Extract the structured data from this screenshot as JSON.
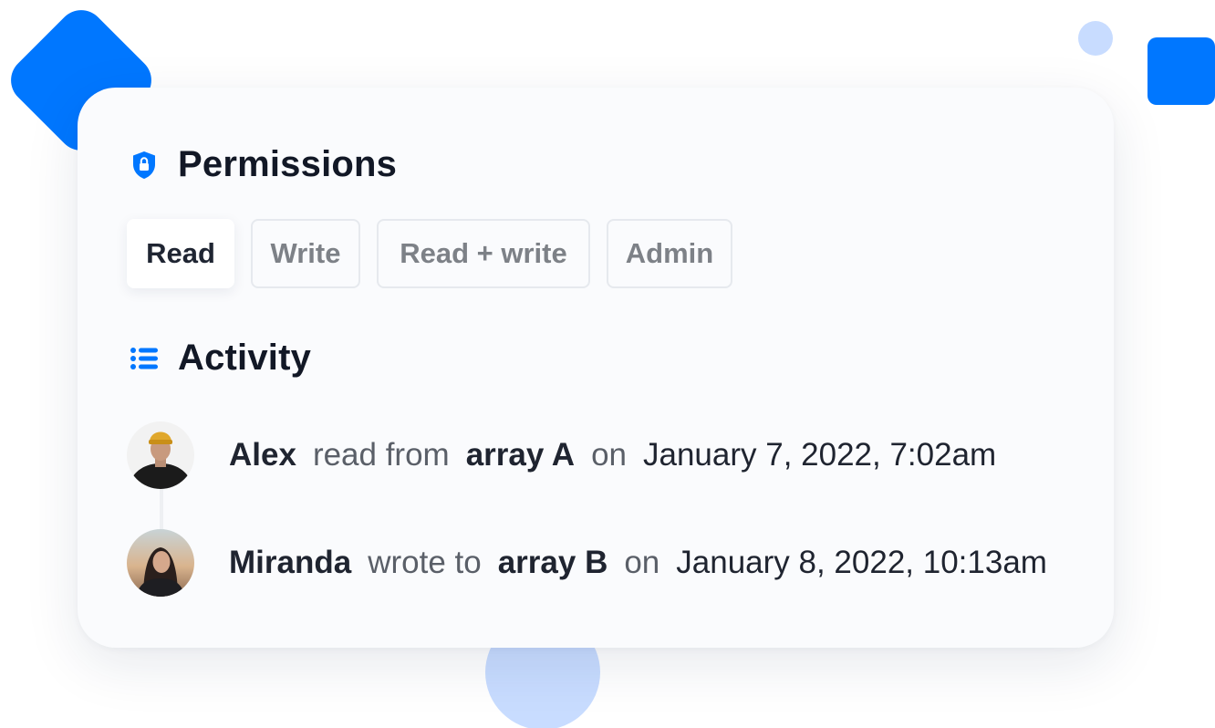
{
  "permissions": {
    "title": "Permissions",
    "icon": "shield-lock-icon",
    "tabs": [
      {
        "label": "Read",
        "active": true
      },
      {
        "label": "Write",
        "active": false
      },
      {
        "label": "Read + write",
        "active": false
      },
      {
        "label": "Admin",
        "active": false
      }
    ]
  },
  "activity": {
    "title": "Activity",
    "icon": "list-icon",
    "items": [
      {
        "user": "Alex",
        "action": "read from",
        "target": "array A",
        "on": "on",
        "date": "January 7, 2022, 7:02am"
      },
      {
        "user": "Miranda",
        "action": "wrote to",
        "target": "array B",
        "on": "on",
        "date": "January 8, 2022, 10:13am"
      }
    ]
  },
  "colors": {
    "accent": "#0077ff",
    "accent_light": "#c8dcff",
    "card_bg": "#fafbfd",
    "text": "#1f2430"
  }
}
